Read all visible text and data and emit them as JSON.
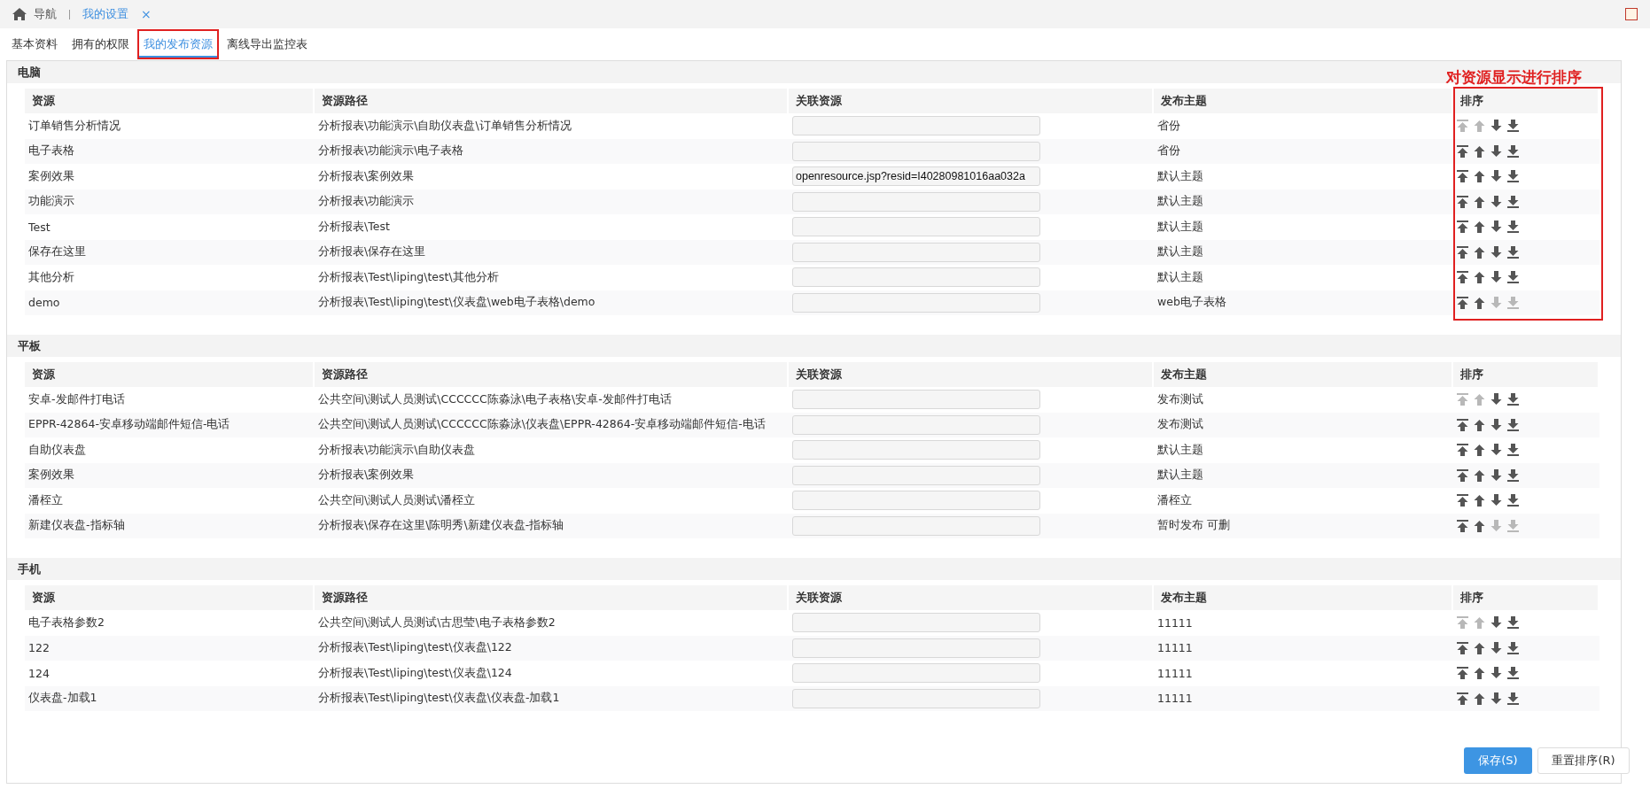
{
  "breadcrumb": {
    "home": "导航",
    "current": "我的设置",
    "close": "×"
  },
  "tabs": [
    {
      "label": "基本资料",
      "selected": false,
      "annotated": false
    },
    {
      "label": "拥有的权限",
      "selected": false,
      "annotated": false
    },
    {
      "label": "我的发布资源",
      "selected": true,
      "annotated": true
    },
    {
      "label": "离线导出监控表",
      "selected": false,
      "annotated": false
    }
  ],
  "annotation": "对资源显示进行排序",
  "sections": [
    {
      "title": "电脑",
      "annotated": true,
      "columns": [
        "资源",
        "资源路径",
        "关联资源",
        "发布主题",
        "排序"
      ],
      "rows": [
        {
          "name": "订单销售分析情况",
          "path": "分析报表\\功能演示\\自助仪表盘\\订单销售分析情况",
          "link": "",
          "theme": "省份",
          "up_disabled": true,
          "down_disabled": false
        },
        {
          "name": "电子表格",
          "path": "分析报表\\功能演示\\电子表格",
          "link": "",
          "theme": "省份",
          "up_disabled": false,
          "down_disabled": false
        },
        {
          "name": "案例效果",
          "path": "分析报表\\案例效果",
          "link": "openresource.jsp?resid=I40280981016aa032a",
          "theme": "默认主题",
          "up_disabled": false,
          "down_disabled": false
        },
        {
          "name": "功能演示",
          "path": "分析报表\\功能演示",
          "link": "",
          "theme": "默认主题",
          "up_disabled": false,
          "down_disabled": false
        },
        {
          "name": "Test",
          "path": "分析报表\\Test",
          "link": "",
          "theme": "默认主题",
          "up_disabled": false,
          "down_disabled": false
        },
        {
          "name": "保存在这里",
          "path": "分析报表\\保存在这里",
          "link": "",
          "theme": "默认主题",
          "up_disabled": false,
          "down_disabled": false
        },
        {
          "name": "其他分析",
          "path": "分析报表\\Test\\liping\\test\\其他分析",
          "link": "",
          "theme": "默认主题",
          "up_disabled": false,
          "down_disabled": false
        },
        {
          "name": "demo",
          "path": "分析报表\\Test\\liping\\test\\仪表盘\\web电子表格\\demo",
          "link": "",
          "theme": "web电子表格",
          "up_disabled": false,
          "down_disabled": true
        }
      ]
    },
    {
      "title": "平板",
      "annotated": false,
      "columns": [
        "资源",
        "资源路径",
        "关联资源",
        "发布主题",
        "排序"
      ],
      "rows": [
        {
          "name": "安卓-发邮件打电话",
          "path": "公共空间\\测试人员测试\\CCCCCC陈淼泳\\电子表格\\安卓-发邮件打电话",
          "link": "",
          "theme": "发布测试",
          "up_disabled": true,
          "down_disabled": false
        },
        {
          "name": "EPPR-42864-安卓移动端邮件短信-电话",
          "path": "公共空间\\测试人员测试\\CCCCCC陈淼泳\\仪表盘\\EPPR-42864-安卓移动端邮件短信-电话",
          "link": "",
          "theme": "发布测试",
          "up_disabled": false,
          "down_disabled": false
        },
        {
          "name": "自助仪表盘",
          "path": "分析报表\\功能演示\\自助仪表盘",
          "link": "",
          "theme": "默认主题",
          "up_disabled": false,
          "down_disabled": false
        },
        {
          "name": "案例效果",
          "path": "分析报表\\案例效果",
          "link": "",
          "theme": "默认主题",
          "up_disabled": false,
          "down_disabled": false
        },
        {
          "name": "潘桎立",
          "path": "公共空间\\测试人员测试\\潘桎立",
          "link": "",
          "theme": "潘桎立",
          "up_disabled": false,
          "down_disabled": false
        },
        {
          "name": "新建仪表盘-指标轴",
          "path": "分析报表\\保存在这里\\陈明秀\\新建仪表盘-指标轴",
          "link": "",
          "theme": "暂时发布 可删",
          "up_disabled": false,
          "down_disabled": true
        }
      ]
    },
    {
      "title": "手机",
      "annotated": false,
      "columns": [
        "资源",
        "资源路径",
        "关联资源",
        "发布主题",
        "排序"
      ],
      "rows": [
        {
          "name": "电子表格参数2",
          "path": "公共空间\\测试人员测试\\古思莹\\电子表格参数2",
          "link": "",
          "theme": "11111",
          "up_disabled": true,
          "down_disabled": false
        },
        {
          "name": "122",
          "path": "分析报表\\Test\\liping\\test\\仪表盘\\122",
          "link": "",
          "theme": "11111",
          "up_disabled": false,
          "down_disabled": false
        },
        {
          "name": "124",
          "path": "分析报表\\Test\\liping\\test\\仪表盘\\124",
          "link": "",
          "theme": "11111",
          "up_disabled": false,
          "down_disabled": false
        },
        {
          "name": "仪表盘-加载1",
          "path": "分析报表\\Test\\liping\\test\\仪表盘\\仪表盘-加载1",
          "link": "",
          "theme": "11111",
          "up_disabled": false,
          "down_disabled": false
        }
      ]
    }
  ],
  "buttons": {
    "save": "保存(S)",
    "reset": "重置排序(R)"
  }
}
